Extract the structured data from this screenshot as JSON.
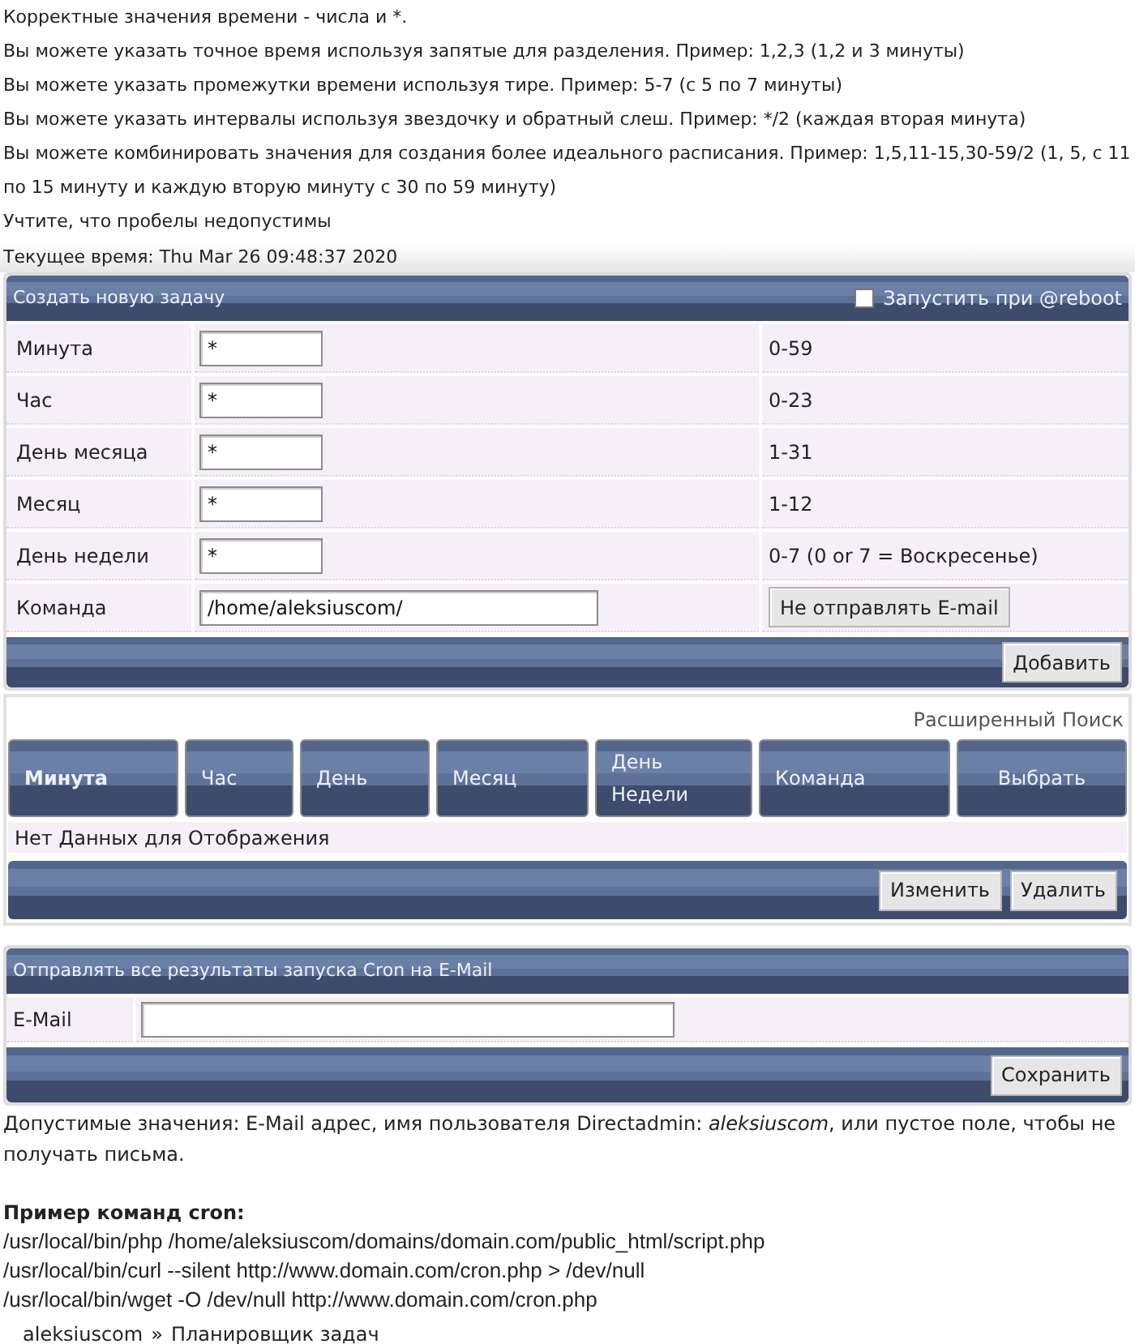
{
  "instructions": [
    "Корректные значения времени - числа и *.",
    "Вы можете указать точное время используя запятые для разделения. Пример: 1,2,3 (1,2 и 3 минуты)",
    "Вы можете указать промежутки времени используя тире. Пример: 5-7 (с 5 по 7 минуты)",
    "Вы можете указать интервалы используя звездочку и обратный слеш. Пример: */2 (каждая вторая минута)",
    "Вы можете комбинировать значения для создания более идеального расписания. Пример: 1,5,11-15,30-59/2 (1, 5, с 11 по 15 минуту и каждую вторую минуту с 30 по 59 минуту)",
    "Учтите, что пробелы недопустимы"
  ],
  "current_time": "Текущее время: Thu Mar 26 09:48:37 2020",
  "create_task": {
    "title": "Создать новую задачу",
    "reboot": {
      "label": "Запустить при @reboot",
      "checked": false
    },
    "fields": [
      {
        "kind": "time",
        "label": "Минута",
        "value": "*",
        "range": "0-59"
      },
      {
        "kind": "time",
        "label": "Час",
        "value": "*",
        "range": "0-23"
      },
      {
        "kind": "time",
        "label": "День месяца",
        "value": "*",
        "range": "1-31"
      },
      {
        "kind": "time",
        "label": "Месяц",
        "value": "*",
        "range": "1-12"
      },
      {
        "kind": "time",
        "label": "День недели",
        "value": "*",
        "range": "0-7 (0 or 7 = Воскресенье)"
      },
      {
        "kind": "command",
        "label": "Команда",
        "value": "/home/aleksiuscom/",
        "button": "Не отправлять E-mail"
      }
    ],
    "submit": "Добавить"
  },
  "advanced_search": "Расширенный Поиск",
  "table": {
    "columns": [
      {
        "label": "Минута",
        "sorted": true
      },
      {
        "label": "Час",
        "sorted": false
      },
      {
        "label": "День",
        "sorted": false
      },
      {
        "label": "Месяц",
        "sorted": false
      },
      {
        "label": "День Недели",
        "sorted": false
      },
      {
        "label": "Команда",
        "sorted": false
      },
      {
        "label": "Выбрать",
        "sorted": false
      }
    ],
    "empty_message": "Нет Данных для Отображения",
    "buttons": [
      "Изменить",
      "Удалить"
    ]
  },
  "email_panel": {
    "title": "Отправлять все результаты запуска Cron на E-Mail",
    "field_label": "E-Mail",
    "submit": "Сохранить"
  },
  "email_note": "Допустимые значения: E-Mail адрес, имя пользователя Directadmin: *aleksiuscom*, или пустое поле, чтобы не получать письма.",
  "examples": {
    "title": "Пример команд cron:",
    "commands": [
      "/usr/local/bin/php /home/aleksiuscom/domains/domain.com/public_html/script.php",
      "/usr/local/bin/curl --silent http://www.domain.com/cron.php > /dev/null",
      "/usr/local/bin/wget -O /dev/null http://www.domain.com/cron.php"
    ]
  },
  "breadcrumb": {
    "items": [
      "aleksiuscom",
      "Планировщик задач"
    ],
    "separator": "»"
  }
}
